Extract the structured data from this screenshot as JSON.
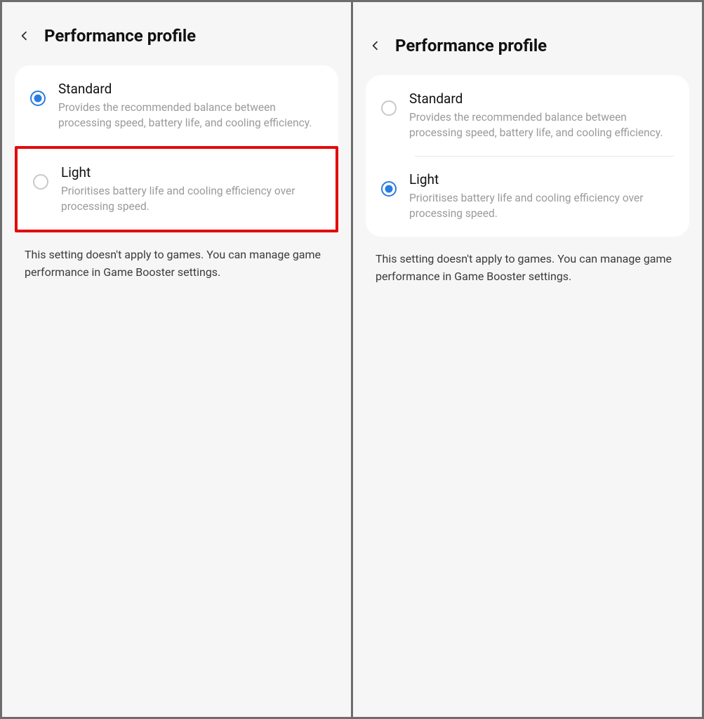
{
  "left": {
    "title": "Performance profile",
    "options": [
      {
        "title": "Standard",
        "desc": "Provides the recommended balance between processing speed, battery life, and cooling efficiency.",
        "selected": true,
        "highlighted": false
      },
      {
        "title": "Light",
        "desc": "Prioritises battery life and cooling efficiency over processing speed.",
        "selected": false,
        "highlighted": true
      }
    ],
    "note": "This setting doesn't apply to games. You can manage game performance in Game Booster settings."
  },
  "right": {
    "title": "Performance profile",
    "options": [
      {
        "title": "Standard",
        "desc": "Provides the recommended balance between processing speed, battery life, and cooling efficiency.",
        "selected": false,
        "highlighted": false
      },
      {
        "title": "Light",
        "desc": "Prioritises battery life and cooling efficiency over processing speed.",
        "selected": true,
        "highlighted": false
      }
    ],
    "note": "This setting doesn't apply to games. You can manage game performance in Game Booster settings."
  }
}
